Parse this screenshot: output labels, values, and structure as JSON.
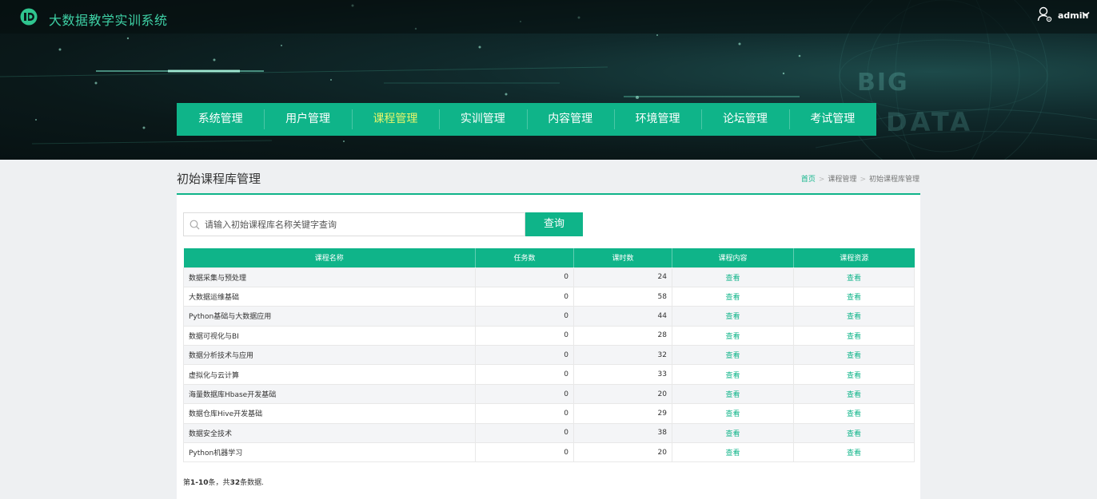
{
  "header": {
    "site_title": "大数据教学实训系统",
    "username": "admin",
    "bg_text_1": "BIG",
    "bg_text_2": "DATA"
  },
  "nav": {
    "items": [
      "系统管理",
      "用户管理",
      "课程管理",
      "实训管理",
      "内容管理",
      "环境管理",
      "论坛管理",
      "考试管理"
    ],
    "active": "课程管理"
  },
  "page": {
    "title": "初始课程库管理",
    "breadcrumb": [
      "首页",
      "课程管理",
      "初始课程库管理"
    ]
  },
  "search": {
    "placeholder": "请输入初始课程库名称关键字查询",
    "value": "",
    "button_label": "查询"
  },
  "table": {
    "columns": [
      "课程名称",
      "任务数",
      "课时数",
      "课程内容",
      "课程资源"
    ],
    "rows": [
      {
        "name": "数据采集与预处理",
        "tasks": "0",
        "hours": "24",
        "content": "查看",
        "resource": "查看"
      },
      {
        "name": "大数据运维基础",
        "tasks": "0",
        "hours": "58",
        "content": "查看",
        "resource": "查看"
      },
      {
        "name": "Python基础与大数据应用",
        "tasks": "0",
        "hours": "44",
        "content": "查看",
        "resource": "查看"
      },
      {
        "name": "数据可视化与BI",
        "tasks": "0",
        "hours": "28",
        "content": "查看",
        "resource": "查看"
      },
      {
        "name": "数据分析技术与应用",
        "tasks": "0",
        "hours": "32",
        "content": "查看",
        "resource": "查看"
      },
      {
        "name": "虚拟化与云计算",
        "tasks": "0",
        "hours": "33",
        "content": "查看",
        "resource": "查看"
      },
      {
        "name": "海量数据库Hbase开发基础",
        "tasks": "0",
        "hours": "20",
        "content": "查看",
        "resource": "查看"
      },
      {
        "name": "数据仓库Hive开发基础",
        "tasks": "0",
        "hours": "29",
        "content": "查看",
        "resource": "查看"
      },
      {
        "name": "数据安全技术",
        "tasks": "0",
        "hours": "38",
        "content": "查看",
        "resource": "查看"
      },
      {
        "name": "Python机器学习",
        "tasks": "0",
        "hours": "20",
        "content": "查看",
        "resource": "查看"
      }
    ]
  },
  "summary": {
    "prefix": "第",
    "range": "1-10",
    "middle": "条，共",
    "total": "32",
    "suffix": "条数据."
  },
  "colors": {
    "accent": "#0fb489",
    "active_nav_text": "#e6f56a",
    "header_bg": "#0a1819"
  },
  "icons": {
    "logo": "logo-icon",
    "user": "user-icon",
    "dropdown": "chevron-down-icon",
    "search": "search-icon"
  }
}
